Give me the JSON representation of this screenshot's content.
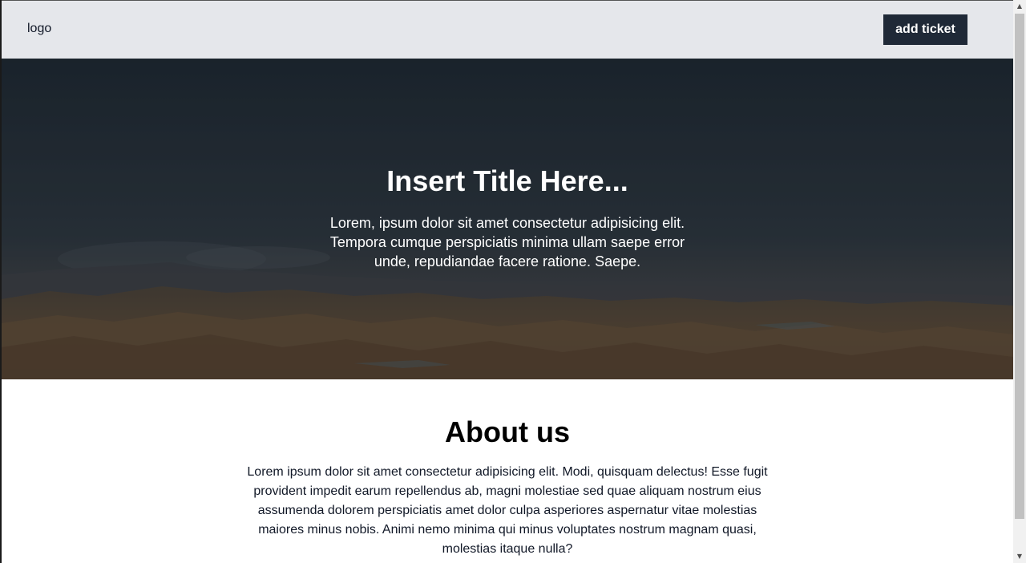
{
  "navbar": {
    "logo_text": "logo",
    "add_button_label": "add ticket"
  },
  "hero": {
    "title": "Insert Title Here...",
    "text": "Lorem, ipsum dolor sit amet consectetur adipisicing elit. Tempora cumque perspiciatis minima ullam saepe error unde, repudiandae facere ratione. Saepe."
  },
  "about": {
    "title": "About us",
    "text": "Lorem ipsum dolor sit amet consectetur adipisicing elit. Modi, quisquam delectus! Esse fugit provident impedit earum repellendus ab, magni molestiae sed quae aliquam nostrum eius assumenda dolorem perspiciatis amet dolor culpa asperiores aspernatur vitae molestias maiores minus nobis. Animi nemo minima qui minus voluptates nostrum magnam quasi, molestias itaque nulla?"
  },
  "scrollbar": {
    "up_icon": "arrow-up-icon",
    "down_icon": "arrow-down-icon"
  },
  "colors": {
    "navbar_bg": "#e5e7eb",
    "button_bg": "#1f2937",
    "button_text": "#ffffff",
    "hero_text": "#ffffff"
  }
}
